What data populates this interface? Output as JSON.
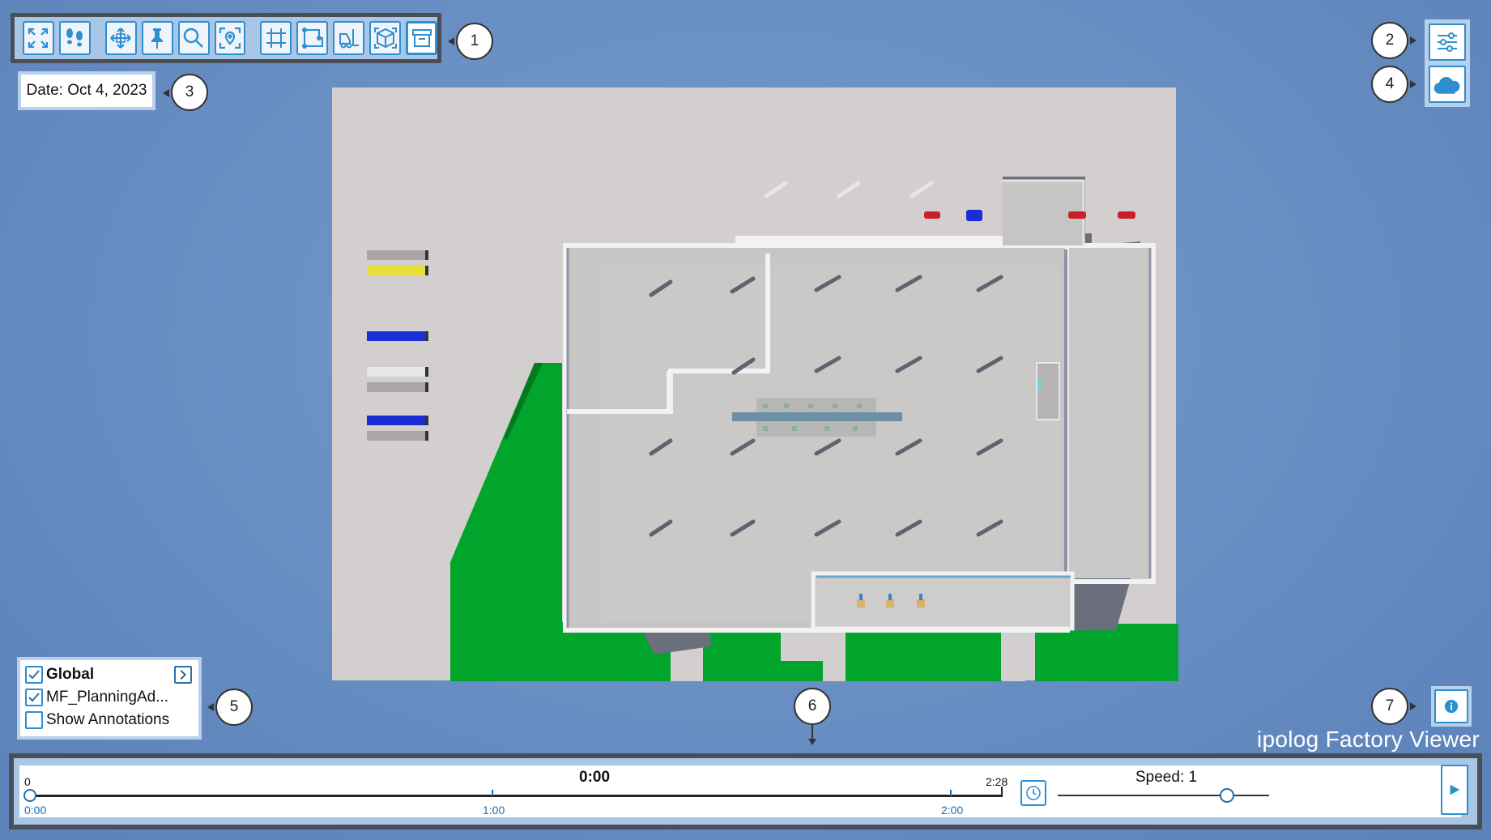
{
  "toolbar": {
    "buttons": [
      {
        "icon": "fullscreen-icon"
      },
      {
        "icon": "footsteps-icon"
      },
      {
        "icon": "move-icon"
      },
      {
        "icon": "pin-icon"
      },
      {
        "icon": "magnifier-icon"
      },
      {
        "icon": "focus-location-icon"
      },
      {
        "icon": "grid-icon"
      },
      {
        "icon": "area-measure-icon"
      },
      {
        "icon": "forklift-icon"
      },
      {
        "icon": "cube-icon"
      },
      {
        "icon": "archive-icon"
      }
    ]
  },
  "callouts": {
    "c1": "1",
    "c2": "2",
    "c3": "3",
    "c4": "4",
    "c5": "5",
    "c6": "6",
    "c7": "7"
  },
  "date_label": "Date: Oct 4, 2023",
  "layers": {
    "items": [
      {
        "label": "Global",
        "checked": true,
        "bold": true
      },
      {
        "label": "MF_PlanningAd...",
        "checked": true
      },
      {
        "label": "Show Annotations",
        "checked": false
      }
    ]
  },
  "brand": "ipolog Factory Viewer",
  "timeline": {
    "start_value": "0",
    "current_time": "0:00",
    "end_value": "2:28",
    "ticks": [
      "0:00",
      "1:00",
      "2:00"
    ],
    "progress": 0,
    "speed_label": "Speed: 1",
    "speed_level": 0.8
  },
  "colors": {
    "accent": "#2d8fd0",
    "panel_bg": "#b9d0ea",
    "frame": "#4a4f57",
    "ground": "#d3cfcf",
    "grass": "#00a82d",
    "floor": "#c9c6c6"
  }
}
